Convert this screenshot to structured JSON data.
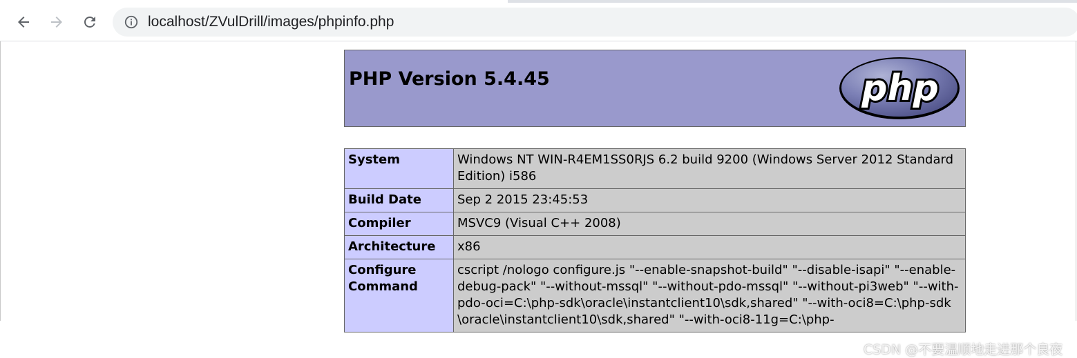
{
  "browser": {
    "url": "localhost/ZVulDrill/images/phpinfo.php",
    "icons": {
      "back": "arrow-left",
      "forward": "arrow-right",
      "reload": "reload",
      "site_info": "info-circle"
    }
  },
  "phpinfo": {
    "title": "PHP Version 5.4.45",
    "logo_text": "php",
    "colors": {
      "header_bg": "#9999cc",
      "key_bg": "#ccccff",
      "value_bg": "#cccccc"
    },
    "rows": [
      {
        "key": "System",
        "value": "Windows NT WIN-R4EM1SS0RJS 6.2 build 9200 (Windows Server 2012 Standard Edition) i586"
      },
      {
        "key": "Build Date",
        "value": "Sep 2 2015 23:45:53"
      },
      {
        "key": "Compiler",
        "value": "MSVC9 (Visual C++ 2008)"
      },
      {
        "key": "Architecture",
        "value": "x86"
      },
      {
        "key": "Configure Command",
        "value": "cscript /nologo configure.js \"--enable-snapshot-build\" \"--disable-isapi\" \"--enable-debug-pack\" \"--without-mssql\" \"--without-pdo-mssql\" \"--without-pi3web\" \"--with-pdo-oci=C:\\php-sdk\\oracle\\instantclient10\\sdk,shared\" \"--with-oci8=C:\\php-sdk\\oracle\\instantclient10\\sdk,shared\" \"--with-oci8-11g=C:\\php-"
      }
    ]
  },
  "watermark": "CSDN @不要温顺地走进那个良夜"
}
